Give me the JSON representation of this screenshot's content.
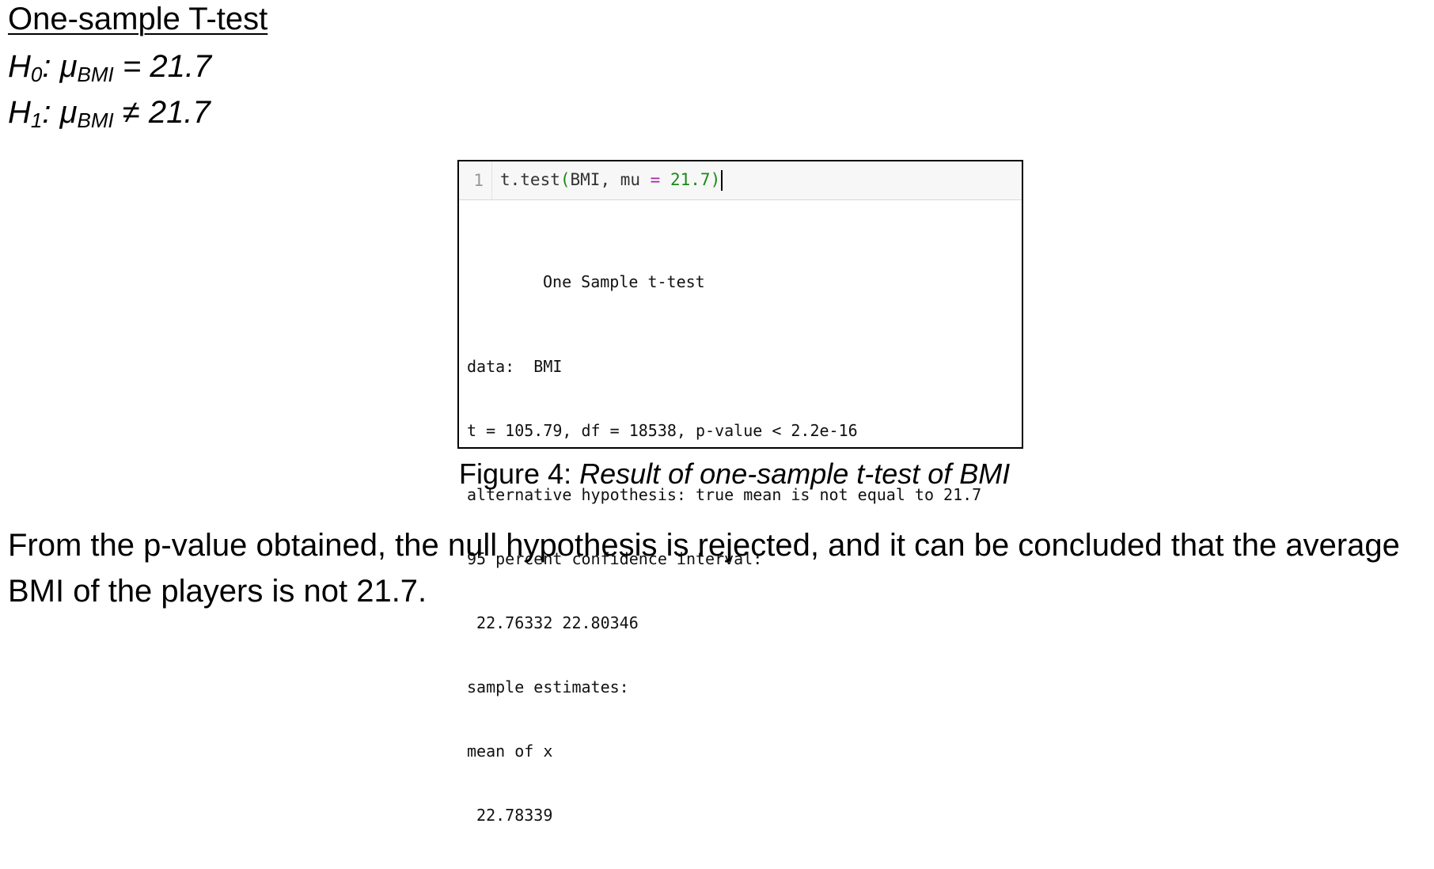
{
  "heading": "One-sample T-test",
  "hypotheses": {
    "h0": {
      "prefix": "H",
      "sub": "0",
      "mid": ": μ",
      "param_sub": "BMI",
      "rel": " = 21.7"
    },
    "h1": {
      "prefix": "H",
      "sub": "1",
      "mid": ": μ",
      "param_sub": "BMI",
      "rel": " ≠ 21.7"
    }
  },
  "code_cell": {
    "line_number": "1",
    "code": {
      "fn": "t.test",
      "open": "(",
      "arg1": "BMI, mu ",
      "op": "=",
      "space": " ",
      "num": "21.7",
      "close": ")"
    },
    "output": {
      "title": "One Sample t-test",
      "lines": [
        "data:  BMI",
        "t = 105.79, df = 18538, p-value < 2.2e-16",
        "alternative hypothesis: true mean is not equal to 21.7",
        "95 percent confidence interval:",
        " 22.76332 22.80346",
        "sample estimates:",
        "mean of x",
        " 22.78339"
      ]
    }
  },
  "caption": {
    "label": "Figure 4: ",
    "text": "Result of one-sample t-test of BMI"
  },
  "conclusion": "From the p-value obtained, the null hypothesis is rejected, and it can be concluded that the average BMI of the players is not 21.7."
}
